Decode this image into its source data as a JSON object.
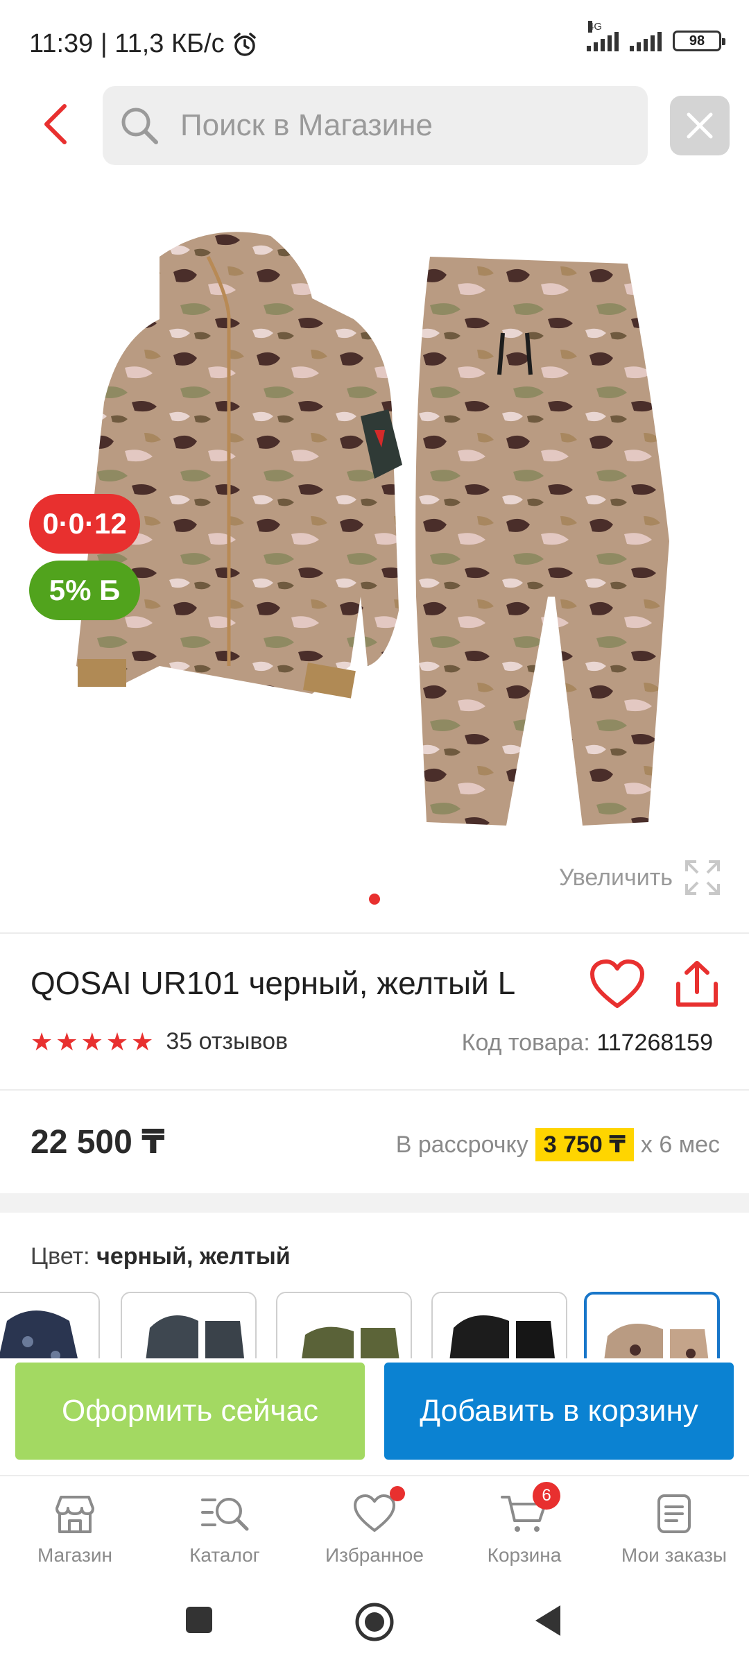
{
  "status_bar": {
    "time_speed": "11:39 | 11,3 КБ/с",
    "network": "4G",
    "battery": "98"
  },
  "search": {
    "placeholder": "Поиск в Магазине"
  },
  "badges": {
    "promo": "0·0·12",
    "bonus": "5% Б"
  },
  "gallery": {
    "zoom_label": "Увеличить"
  },
  "product": {
    "title": "QOSAI UR101 черный, желтый L",
    "rating_stars": 5,
    "reviews": "35 отзывов",
    "sku_label": "Код товара:",
    "sku_value": "117268159",
    "price": "22 500 ₸",
    "installment_prefix": "В рассрочку",
    "installment_amount": "3 750 ₸",
    "installment_suffix": "х 6 мес",
    "color_label": "Цвет:",
    "color_value": "черный, желтый"
  },
  "actions": {
    "checkout": "Оформить сейчас",
    "add_to_cart": "Добавить в корзину"
  },
  "nav": {
    "items": [
      {
        "label": "Магазин",
        "icon": "store-icon"
      },
      {
        "label": "Каталог",
        "icon": "catalog-search-icon"
      },
      {
        "label": "Избранное",
        "icon": "heart-icon"
      },
      {
        "label": "Корзина",
        "icon": "cart-icon"
      },
      {
        "label": "Мои заказы",
        "icon": "orders-icon"
      }
    ],
    "cart_count": "6"
  },
  "colors": {
    "accent_red": "#e8302f",
    "primary_blue": "#0b82d2",
    "checkout_green": "#a3d962",
    "installment_yellow": "#ffd500"
  }
}
